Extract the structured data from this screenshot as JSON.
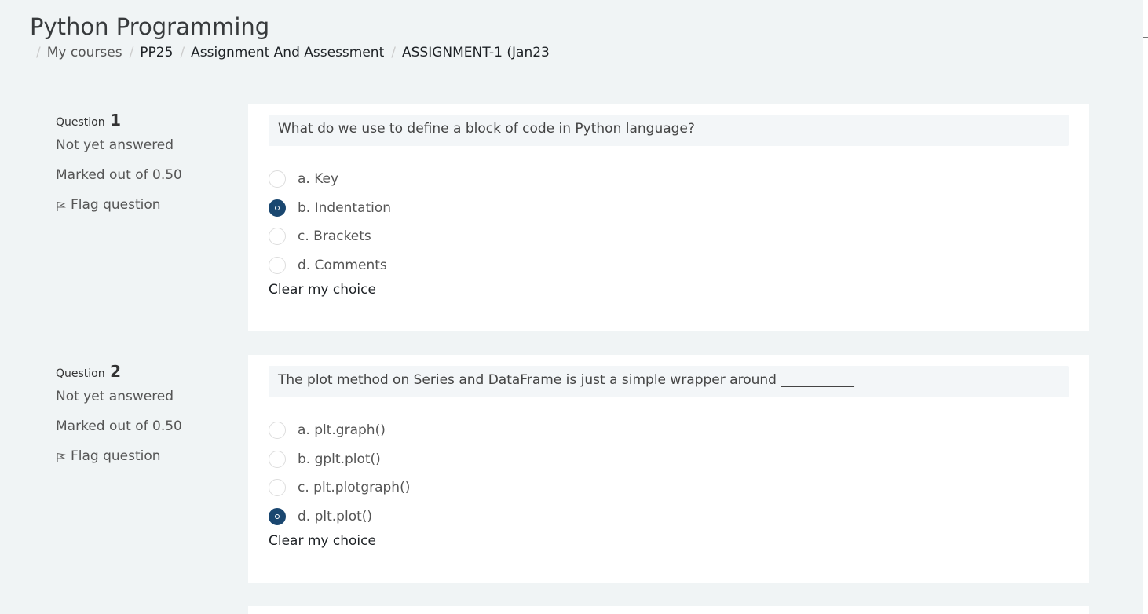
{
  "page": {
    "title": "Python Programming"
  },
  "breadcrumb": [
    {
      "label": "My courses"
    },
    {
      "label": "PP25"
    },
    {
      "label": "Assignment And Assessment"
    },
    {
      "label": "ASSIGNMENT-1 (Jan23"
    }
  ],
  "questions": [
    {
      "label": "Question",
      "number": "1",
      "state": "Not yet answered",
      "marks": "Marked out of 0.50",
      "flag_label": "Flag question",
      "text": "What do we use to define a block of code in Python language?",
      "answers": [
        {
          "label": "a. Key",
          "checked": false
        },
        {
          "label": "b. Indentation",
          "checked": true
        },
        {
          "label": "c. Brackets",
          "checked": false
        },
        {
          "label": "d. Comments",
          "checked": false
        }
      ],
      "clear_label": "Clear my choice"
    },
    {
      "label": "Question",
      "number": "2",
      "state": "Not yet answered",
      "marks": "Marked out of 0.50",
      "flag_label": "Flag question",
      "text": "The plot method on Series and DataFrame is just a simple wrapper around ___________",
      "answers": [
        {
          "label": "a. plt.graph()",
          "checked": false
        },
        {
          "label": "b. gplt.plot()",
          "checked": false
        },
        {
          "label": "c. plt.plotgraph()",
          "checked": false
        },
        {
          "label": "d. plt.plot()",
          "checked": true
        }
      ],
      "clear_label": "Clear my choice"
    }
  ],
  "colors": {
    "background": "#f0f4f5",
    "card": "#ffffff",
    "radio_checked": "#1a4770",
    "question_text_bg": "#f3f6f8"
  }
}
